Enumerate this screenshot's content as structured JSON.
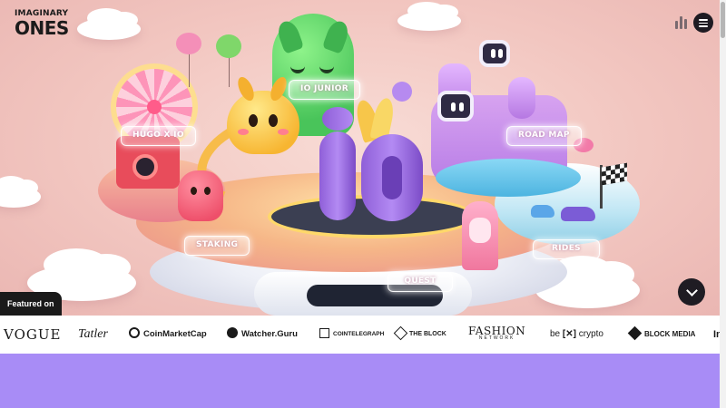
{
  "brand": {
    "logo_top": "IMAGINARY",
    "logo_bottom": "ONES"
  },
  "header": {
    "sound_icon": "sound-bars-icon",
    "menu_icon": "hamburger-menu-icon"
  },
  "map_labels": {
    "io_junior": "IO JUNIOR",
    "hugo_x_io": "HUGO X IO",
    "road_map": "ROAD MAP",
    "staking": "STAKING",
    "rides": "RIDES",
    "quest": "QUEST"
  },
  "scroll_down_icon": "chevron-down-icon",
  "featured": {
    "label": "Featured on",
    "press": [
      "VOGUE",
      "Tatler",
      "CoinMarketCap",
      "Watcher.Guru",
      "COINTELEGRAPH",
      "THE BLOCK",
      "FASHION",
      "NETWORK",
      "be",
      "[✕]",
      "crypto",
      "BLOCK MEDIA",
      "Im"
    ]
  },
  "colors": {
    "accent_purple": "#a88cf6",
    "dark": "#1a1a1a",
    "hero_pink": "#f3c9c4"
  }
}
